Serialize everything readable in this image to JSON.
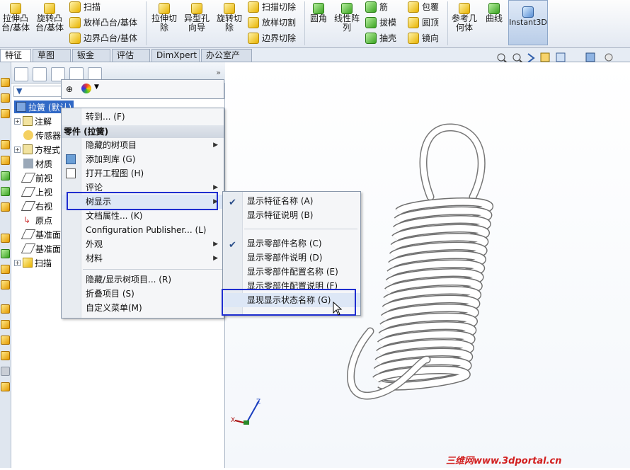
{
  "ribbon": {
    "groups": [
      {
        "label": "拉伸凸\n台/基体"
      },
      {
        "label": "旋转凸\n台/基体"
      },
      {
        "label": "扫描"
      },
      {
        "label": "放样凸台/基体"
      },
      {
        "label": "边界凸台/基体"
      },
      {
        "label": "拉伸切\n除"
      },
      {
        "label": "异型孔\n向导"
      },
      {
        "label": "旋转切\n除"
      },
      {
        "label": "扫描切除"
      },
      {
        "label": "放样切割"
      },
      {
        "label": "边界切除"
      },
      {
        "label": "圆角"
      },
      {
        "label": "线性阵\n列"
      },
      {
        "label": "筋"
      },
      {
        "label": "拔模"
      },
      {
        "label": "抽壳"
      },
      {
        "label": "包覆"
      },
      {
        "label": "圆顶"
      },
      {
        "label": "镜向"
      },
      {
        "label": "参考几\n何体"
      },
      {
        "label": "曲线"
      },
      {
        "label": "Instant3D"
      }
    ]
  },
  "tabs": [
    "特征",
    "草图",
    "钣金",
    "评估",
    "DimXpert",
    "办公室产品"
  ],
  "tree": {
    "root": "拉簧 (默认)",
    "items": [
      "注解",
      "传感器",
      "方程式",
      "材质",
      "前视",
      "上视",
      "右视",
      "原点",
      "基准面",
      "基准面",
      "扫描"
    ]
  },
  "context_menu": {
    "items": [
      "转到... (F)",
      "零件 (拉簧)",
      "隐藏的树项目",
      "添加到库 (G)",
      "打开工程图 (H)",
      "评论",
      "树显示",
      "文档属性... (K)",
      "Configuration Publisher... (L)",
      "外观",
      "材料",
      "隐藏/显示树项目... (R)",
      "折叠项目 (S)",
      "自定义菜单(M)"
    ]
  },
  "submenu": {
    "items": [
      {
        "label": "显示特征名称 (A)",
        "checked": true
      },
      {
        "label": "显示特征说明 (B)",
        "checked": false
      },
      {
        "label": "显示零部件名称 (C)",
        "checked": true
      },
      {
        "label": "显示零部件说明 (D)",
        "checked": false
      },
      {
        "label": "显示零部件配置名称 (E)",
        "checked": false
      },
      {
        "label": "显示零部件配置说明 (F)",
        "checked": false
      },
      {
        "label": "显现显示状态名称 (G)",
        "checked": false
      }
    ]
  },
  "watermark": "三维网www.3dportal.cn",
  "colors": {
    "highlight_box": "#1f2ed0",
    "menu_bg": "#f5f6f8",
    "watermark": "#d21f1f"
  }
}
